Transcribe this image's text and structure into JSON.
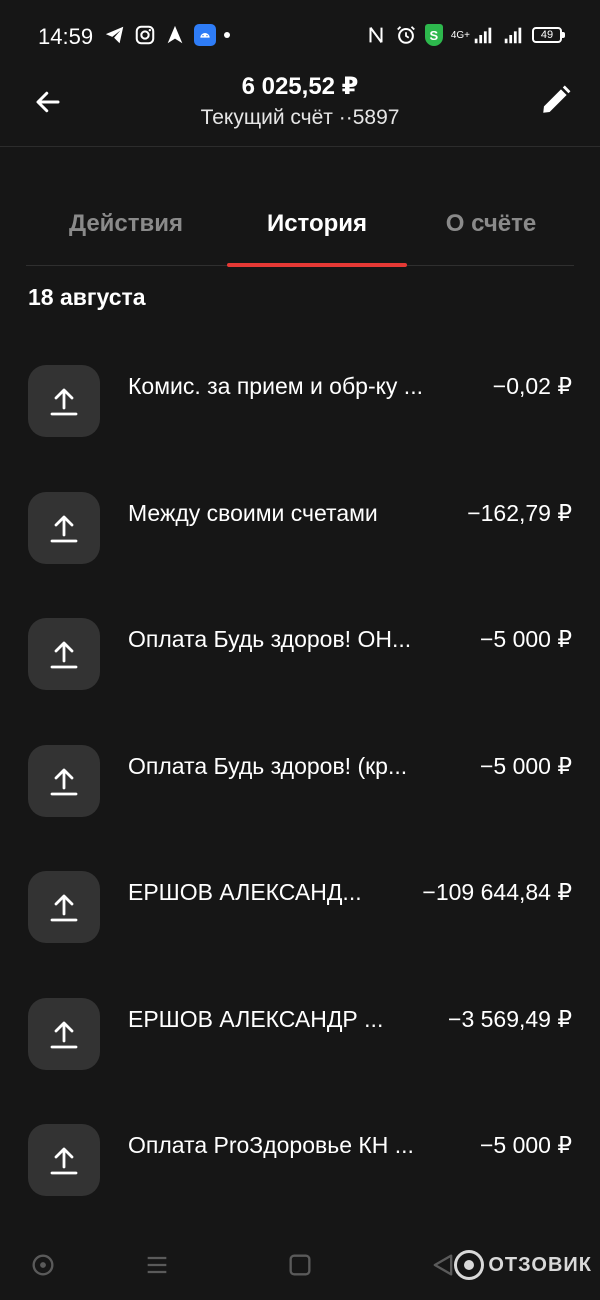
{
  "status_bar": {
    "time": "14:59",
    "network_tag": "4G+",
    "battery_level": "49",
    "shield_label": "S"
  },
  "header": {
    "balance": "6 025,52 ₽",
    "account_name": "Текущий счёт ··5897"
  },
  "tabs": [
    {
      "label": "Действия",
      "active": false
    },
    {
      "label": "История",
      "active": true
    },
    {
      "label": "О счёте",
      "active": false
    }
  ],
  "history": {
    "date": "18 августа",
    "transactions": [
      {
        "title": "Комис. за прием и обр-ку ...",
        "amount": "−0,02 ₽"
      },
      {
        "title": "Между своими счетами",
        "amount": "−162,79 ₽"
      },
      {
        "title": "Оплата Будь здоров! ОН...",
        "amount": "−5 000 ₽"
      },
      {
        "title": "Оплата Будь здоров! (кр...",
        "amount": "−5 000 ₽"
      },
      {
        "title": "ЕРШОВ АЛЕКСАНД...",
        "amount": "−109 644,84 ₽"
      },
      {
        "title": "ЕРШОВ АЛЕКСАНДР ...",
        "amount": "−3 569,49 ₽"
      },
      {
        "title": "Оплата ProЗдоровье КН ...",
        "amount": "−5 000 ₽"
      }
    ]
  },
  "watermark": {
    "text": "ОТЗОВИК"
  },
  "colors": {
    "background": "#161616",
    "accent": "#e53935",
    "icon_bg": "#333333",
    "tab_inactive": "#8a8a8a"
  },
  "icons": {
    "back": "arrow-left-icon",
    "edit": "pencil-icon",
    "transaction": "upload-arrow-icon"
  }
}
